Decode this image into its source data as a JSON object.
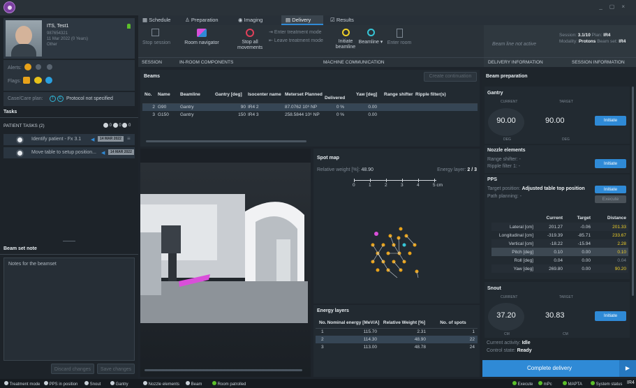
{
  "titlebar": {
    "controls": [
      "_",
      "▢",
      "×"
    ]
  },
  "patient": {
    "name": "ITS, Test1",
    "id": "987654321",
    "dob": "11 Mar 2022",
    "age": "(0 Years)",
    "sex": "Other"
  },
  "alerts_label": "Alerts:",
  "flags_label": "Flags:",
  "care_plan": {
    "label": "Case/Care plan:",
    "badges": [
      "T",
      "E"
    ],
    "value": "Protocol not specified"
  },
  "tasks": {
    "title": "Tasks",
    "patient_tasks": "PATIENT TASKS (2)",
    "counts": [
      "0",
      "0",
      "0"
    ],
    "items": [
      {
        "label": "Identify patient - Fx 3.1",
        "date": "14 MAR 2022"
      },
      {
        "label": "Move table to setup position...",
        "date": "14 MAR 2022"
      }
    ]
  },
  "beamset_note": {
    "title": "Beam set note",
    "text": "Notes for the beamset",
    "discard": "Discard changes",
    "save": "Save changes"
  },
  "tabs": [
    {
      "label": "Schedule"
    },
    {
      "label": "Preparation"
    },
    {
      "label": "Imaging"
    },
    {
      "label": "Delivery"
    },
    {
      "label": "Results"
    }
  ],
  "toolbar": {
    "stop_session": "Stop session",
    "room_navigator": "Room navigator",
    "stop_all": "Stop all movements",
    "enter_treatment": "Enter treatment mode",
    "leave_treatment": "Leave treatment mode",
    "initiate_beamline": "Initiate beamline",
    "beamline": "Beamline",
    "enter_room": "Enter room",
    "beam_line_status": "Beam line not active",
    "groups": [
      "SESSION",
      "IN-ROOM COMPONENTS",
      "MACHINE COMMUNICATION",
      "DELIVERY INFORMATION",
      "SESSION INFORMATION"
    ]
  },
  "session_info": {
    "session_label": "Session:",
    "session": "3.1/10",
    "plan_label": "Plan:",
    "plan": "IR4",
    "modality_label": "Modality:",
    "modality": "Protons",
    "beamset_label": "Beam set:",
    "beamset": "IR4"
  },
  "beams": {
    "title": "Beams",
    "create_continuation": "Create continuation",
    "columns": [
      "No.",
      "Name",
      "Beamline",
      "Gantry [deg]",
      "Isocenter name",
      "Meterset Planned",
      "Delivered",
      "Yaw [deg]",
      "Range shifter",
      "Ripple filter(s)"
    ],
    "rows": [
      [
        "2",
        "G90",
        "Gantry",
        "90",
        "IR4 2",
        "87.0762 10⁶ NP",
        "0 %",
        "0.00",
        "",
        ""
      ],
      [
        "3",
        "G150",
        "Gantry",
        "150",
        "IR4 3",
        "258.5844 10⁶ NP",
        "0 %",
        "0.00",
        "",
        ""
      ]
    ]
  },
  "spot_map": {
    "title": "Spot map",
    "rel_weight_label": "Relative weight [%]:",
    "rel_weight": "48.90",
    "energy_layer_label": "Energy layer:",
    "energy_layer": "2 / 3",
    "scale": [
      "0",
      "1",
      "2",
      "3",
      "4",
      "5 cm"
    ]
  },
  "energy_layers": {
    "title": "Energy layers",
    "columns": [
      "No.",
      "Nominal energy [MeV/A]",
      "Relative Weight [%]",
      "No. of spots"
    ],
    "rows": [
      [
        "1",
        "115.70",
        "2.31",
        "1"
      ],
      [
        "2",
        "114.30",
        "48.90",
        "22"
      ],
      [
        "3",
        "113.00",
        "48.78",
        "24"
      ]
    ]
  },
  "beam_prep": {
    "title": "Beam preparation",
    "gantry": {
      "title": "Gantry",
      "current_label": "CURRENT",
      "target_label": "TARGET",
      "current": "90.00",
      "target": "90.00",
      "unit": "DEG",
      "initiate": "Initiate"
    },
    "nozzle": {
      "title": "Nozzle elements",
      "range_shifter": "Range shifter:",
      "ripple_filter": "Ripple filter 1:",
      "dash": "-",
      "initiate": "Initiate"
    },
    "pps": {
      "title": "PPS",
      "target_label": "Target position:",
      "target_value": "Adjusted table top position",
      "path_label": "Path planning:",
      "path_value": "-",
      "initiate": "Initiate",
      "execute": "Execute",
      "columns": [
        "",
        "Current",
        "Target",
        "Distance"
      ],
      "rows": [
        [
          "Lateral [cm]",
          "201.27",
          "-0.06",
          "201.33"
        ],
        [
          "Longitudinal [cm]",
          "-319.39",
          "-85.71",
          "233.67"
        ],
        [
          "Vertical [cm]",
          "-18.22",
          "-15.94",
          "2.28"
        ],
        [
          "Pitch [deg]",
          "0.10",
          "0.00",
          "0.10"
        ],
        [
          "Roll [deg]",
          "0.04",
          "0.00",
          "0.04"
        ],
        [
          "Yaw [deg]",
          "269.80",
          "0.00",
          "90.20"
        ]
      ]
    },
    "snout": {
      "title": "Snout",
      "current_label": "CURRENT",
      "target_label": "TARGET",
      "current": "37.20",
      "target": "30.83",
      "unit": "CM",
      "initiate": "Initiate"
    },
    "activity_label": "Current activity:",
    "activity": "Idle",
    "control_label": "Control state:",
    "control": "Ready",
    "complete": "Complete delivery"
  },
  "status_left": [
    "Treatment mode",
    "PPS in position",
    "Snout",
    "Gantry",
    "Nozzle elements",
    "Beam",
    "Room patrolled"
  ],
  "status_right": [
    "Execute",
    "mPc",
    "MAPTA",
    "System status",
    "IR4"
  ],
  "colors": {
    "accent": "#2f8ad6",
    "orange": "#e8a21a",
    "yellow": "#f0d028",
    "magenta": "#d94fd9",
    "cyan": "#36c5d6",
    "green": "#5cbf2a",
    "bg": "#1e242b"
  }
}
